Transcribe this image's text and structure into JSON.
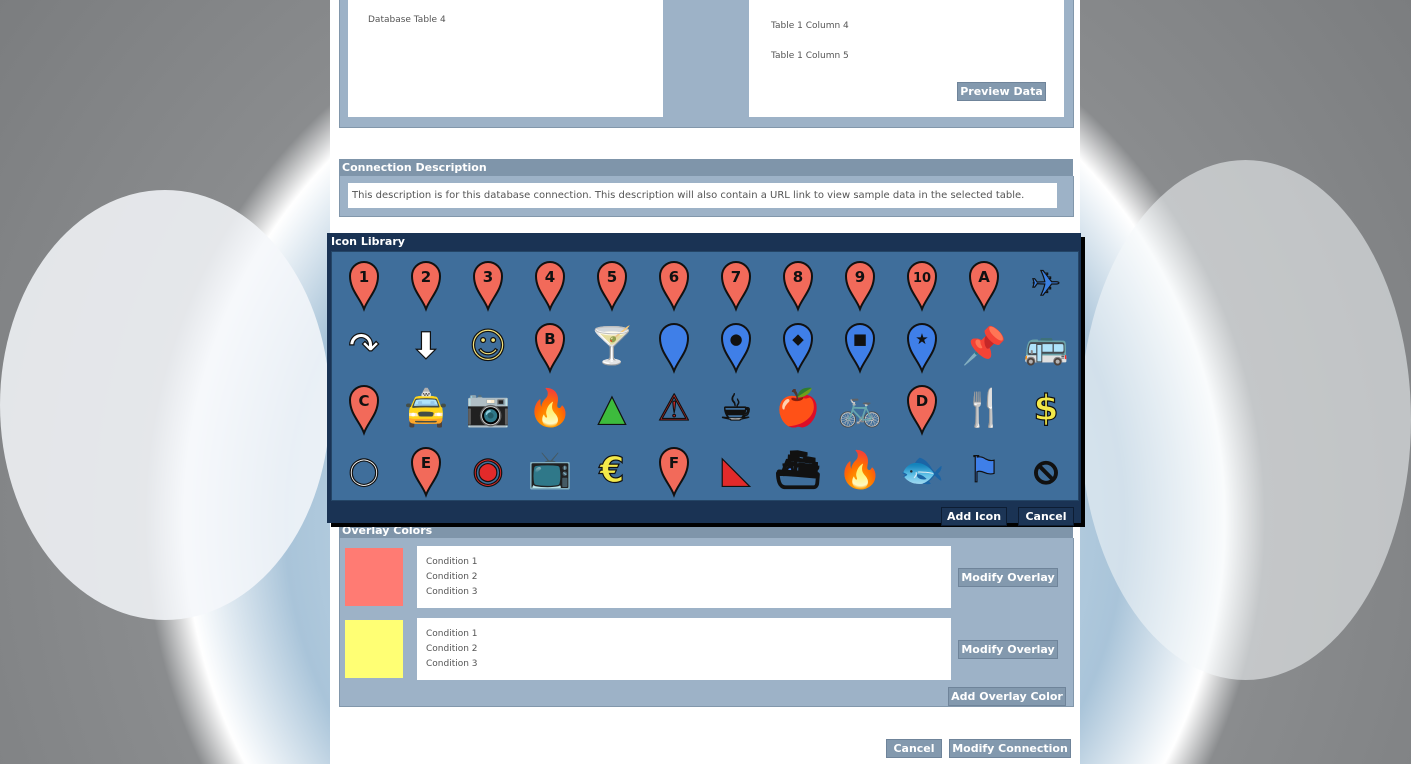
{
  "tables": {
    "left_item": "Database Table 4",
    "right_items": [
      "Table 1 Column 4",
      "Table 1 Column 5"
    ],
    "preview_button": "Preview Data"
  },
  "connection": {
    "heading": "Connection Description",
    "description": "This description is for this database connection. This description will also contain a URL link to view sample data in the selected table."
  },
  "icon_library": {
    "title": "Icon Library",
    "add_button": "Add Icon",
    "cancel_button": "Cancel",
    "rows": [
      [
        {
          "name": "marker-1-icon",
          "kind": "pin",
          "color": "#f26a5a",
          "label": "1"
        },
        {
          "name": "marker-2-icon",
          "kind": "pin",
          "color": "#f26a5a",
          "label": "2"
        },
        {
          "name": "marker-3-icon",
          "kind": "pin",
          "color": "#f26a5a",
          "label": "3"
        },
        {
          "name": "marker-4-icon",
          "kind": "pin",
          "color": "#f26a5a",
          "label": "4"
        },
        {
          "name": "marker-5-icon",
          "kind": "pin",
          "color": "#f26a5a",
          "label": "5"
        },
        {
          "name": "marker-6-icon",
          "kind": "pin",
          "color": "#f26a5a",
          "label": "6"
        },
        {
          "name": "marker-7-icon",
          "kind": "pin",
          "color": "#f26a5a",
          "label": "7"
        },
        {
          "name": "marker-8-icon",
          "kind": "pin",
          "color": "#f26a5a",
          "label": "8"
        },
        {
          "name": "marker-9-icon",
          "kind": "pin",
          "color": "#f26a5a",
          "label": "9"
        },
        {
          "name": "marker-10-icon",
          "kind": "pin",
          "color": "#f26a5a",
          "label": "10"
        },
        {
          "name": "marker-a-icon",
          "kind": "pin",
          "color": "#f26a5a",
          "label": "A"
        },
        {
          "name": "airplane-icon",
          "kind": "glyph",
          "color": "#3a7fe0",
          "glyph": "✈"
        }
      ],
      [
        {
          "name": "turn-arrow-icon",
          "kind": "glyph",
          "color": "#ffffff",
          "glyph": "↷"
        },
        {
          "name": "down-arrow-icon",
          "kind": "glyph",
          "color": "#ffffff",
          "glyph": "⬇"
        },
        {
          "name": "theater-masks-icon",
          "kind": "glyph",
          "color": "#f3e27a",
          "glyph": "☺"
        },
        {
          "name": "marker-b-icon",
          "kind": "pin",
          "color": "#f26a5a",
          "label": "B"
        },
        {
          "name": "cocktail-icon",
          "kind": "glyph",
          "color": "#ffffff",
          "glyph": "🍸"
        },
        {
          "name": "blue-marker-icon",
          "kind": "pin",
          "color": "#3f7fe8",
          "label": ""
        },
        {
          "name": "blue-marker-dot-icon",
          "kind": "pin",
          "color": "#3f7fe8",
          "label": "●"
        },
        {
          "name": "blue-marker-diamond-icon",
          "kind": "pin",
          "color": "#3f7fe8",
          "label": "◆"
        },
        {
          "name": "blue-marker-square-icon",
          "kind": "pin",
          "color": "#3f7fe8",
          "label": "■"
        },
        {
          "name": "blue-marker-star-icon",
          "kind": "pin",
          "color": "#3f7fe8",
          "label": "★"
        },
        {
          "name": "pushpin-icon",
          "kind": "glyph",
          "color": "#3f7fe8",
          "glyph": "📌"
        },
        {
          "name": "bus-icon",
          "kind": "glyph",
          "color": "#3f7fe8",
          "glyph": "🚌"
        }
      ],
      [
        {
          "name": "marker-c-icon",
          "kind": "pin",
          "color": "#f26a5a",
          "label": "C"
        },
        {
          "name": "taxi-icon",
          "kind": "glyph",
          "color": "#3f7fe8",
          "glyph": "🚖"
        },
        {
          "name": "camera-icon",
          "kind": "glyph",
          "color": "#c05ad8",
          "glyph": "📷"
        },
        {
          "name": "campfire-icon",
          "kind": "glyph",
          "color": "#3dbb3d",
          "glyph": "🔥"
        },
        {
          "name": "tent-icon",
          "kind": "glyph",
          "color": "#3dbb3d",
          "glyph": "▲"
        },
        {
          "name": "warning-icon",
          "kind": "glyph",
          "color": "#e22a2a",
          "glyph": "⚠"
        },
        {
          "name": "coffee-icon",
          "kind": "glyph",
          "color": "#ffffff",
          "glyph": "☕"
        },
        {
          "name": "grocery-icon",
          "kind": "glyph",
          "color": "#f3e94a",
          "glyph": "🍎"
        },
        {
          "name": "bicycle-icon",
          "kind": "glyph",
          "color": "#3dbb3d",
          "glyph": "🚲"
        },
        {
          "name": "marker-d-icon",
          "kind": "pin",
          "color": "#f26a5a",
          "label": "D"
        },
        {
          "name": "restaurant-icon",
          "kind": "glyph",
          "color": "#ffffff",
          "glyph": "🍴"
        },
        {
          "name": "dollar-icon",
          "kind": "glyph",
          "color": "#f3e94a",
          "glyph": "$"
        }
      ],
      [
        {
          "name": "circle-icon",
          "kind": "glyph",
          "color": "#ffffff",
          "glyph": "○"
        },
        {
          "name": "marker-e-icon",
          "kind": "pin",
          "color": "#f26a5a",
          "label": "E"
        },
        {
          "name": "heartbeat-icon",
          "kind": "glyph",
          "color": "#e22a2a",
          "glyph": "◉"
        },
        {
          "name": "tv-icon",
          "kind": "glyph",
          "color": "#f3e94a",
          "glyph": "📺"
        },
        {
          "name": "euro-icon",
          "kind": "glyph",
          "color": "#f3e94a",
          "glyph": "€"
        },
        {
          "name": "marker-f-icon",
          "kind": "pin",
          "color": "#f26a5a",
          "label": "F"
        },
        {
          "name": "falling-rocks-icon",
          "kind": "glyph",
          "color": "#e22a2a",
          "glyph": "◣"
        },
        {
          "name": "ferry-icon",
          "kind": "glyph",
          "color": "#3f7fe8",
          "glyph": "⛴"
        },
        {
          "name": "fire-icon",
          "kind": "glyph",
          "color": "#e22a2a",
          "glyph": "🔥"
        },
        {
          "name": "fishing-icon",
          "kind": "glyph",
          "color": "#3f7fe8",
          "glyph": "🐟"
        },
        {
          "name": "flag-icon",
          "kind": "glyph",
          "color": "#3f7fe8",
          "glyph": "⚑"
        },
        {
          "name": "no-entry-icon",
          "kind": "glyph",
          "color": "#ffffff",
          "glyph": "⦸"
        }
      ]
    ]
  },
  "overlays": {
    "heading": "Overlay Colors",
    "items": [
      {
        "color": "#ff7b73",
        "conditions": [
          "Condition 1",
          "Condition 2",
          "Condition 3"
        ],
        "button": "Modify Overlay"
      },
      {
        "color": "#ffff74",
        "conditions": [
          "Condition 1",
          "Condition 2",
          "Condition 3"
        ],
        "button": "Modify Overlay"
      }
    ],
    "add_button": "Add Overlay Color"
  },
  "footer": {
    "cancel_button": "Cancel",
    "modify_button": "Modify Connection"
  }
}
